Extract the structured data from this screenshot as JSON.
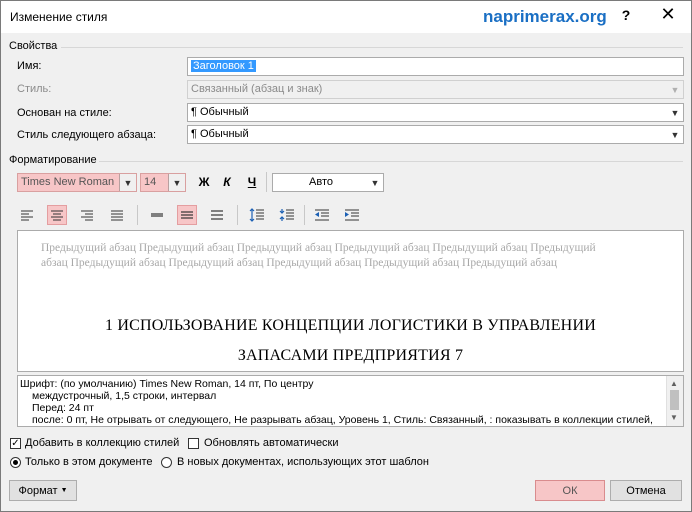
{
  "window": {
    "title": "Изменение стиля",
    "help_glyph": "?",
    "close_glyph": "✕"
  },
  "watermark": "naprimerax.org",
  "properties": {
    "section_label": "Свойства",
    "name_label": "Имя:",
    "name_value": "Заголовок 1",
    "style_type_label": "Стиль:",
    "style_type_value": "Связанный (абзац и знак)",
    "based_on_label": "Основан на стиле:",
    "based_on_value": "¶  Обычный",
    "next_style_label": "Стиль следующего абзаца:",
    "next_style_value": "¶  Обычный"
  },
  "formatting": {
    "section_label": "Форматирование",
    "font_name": "Times New Roman",
    "font_size": "14",
    "bold": "Ж",
    "italic": "К",
    "underline": "Ч",
    "color": "Авто"
  },
  "preview": {
    "previous_paragraph": "Предыдущий абзац Предыдущий абзац Предыдущий абзац Предыдущий абзац Предыдущий абзац Предыдущий абзац Предыдущий абзац Предыдущий абзац Предыдущий абзац Предыдущий абзац Предыдущий абзац",
    "heading_line1": "1 ИСПОЛЬЗОВАНИЕ КОНЦЕПЦИИ ЛОГИСТИКИ В УПРАВЛЕНИИ",
    "heading_line2": "ЗАПАСАМИ ПРЕДПРИЯТИЯ       7"
  },
  "description": {
    "line1": "Шрифт: (по умолчанию) Times New Roman, 14 пт, По центру",
    "line2": "междустрочный,  1,5 строки, интервал",
    "line3": "Перед:  24 пт",
    "line4": "после: 0 пт, Не отрывать от следующего, Не разрывать абзац, Уровень 1, Стиль: Связанный, : показывать в коллекции стилей,"
  },
  "options": {
    "add_to_gallery": "Добавить в коллекцию стилей",
    "add_to_gallery_checked": true,
    "auto_update": "Обновлять автоматически",
    "auto_update_checked": false,
    "only_this_doc": "Только в этом документе",
    "new_docs": "В новых документах, использующих этот шаблон"
  },
  "buttons": {
    "format": "Формат",
    "ok": "ОК",
    "cancel": "Отмена"
  },
  "colors": {
    "highlight": "#f7c6c7",
    "selection": "#3399ff",
    "watermark": "#1a6fc4"
  }
}
